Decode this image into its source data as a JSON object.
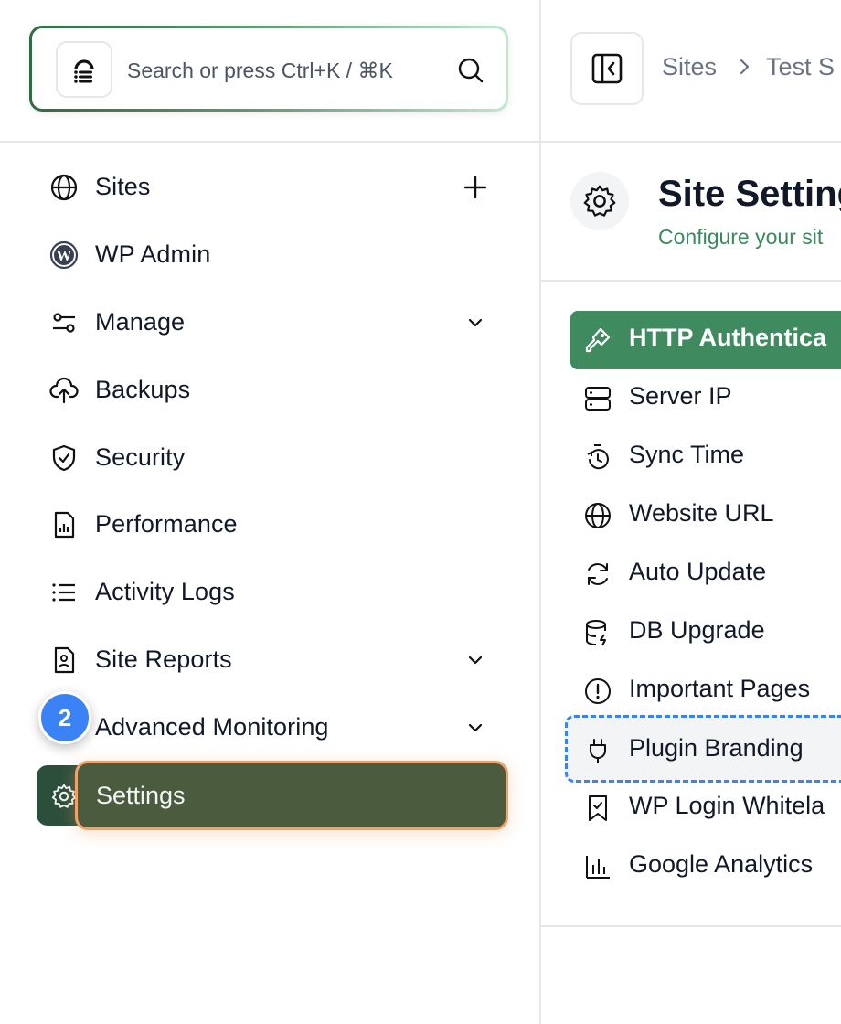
{
  "search": {
    "placeholder": "Search or press Ctrl+K / ⌘K"
  },
  "sidebar": {
    "items": [
      {
        "label": "Sites",
        "icon": "globe-icon",
        "trail": "plus-icon"
      },
      {
        "label": "WP Admin",
        "icon": "wordpress-icon"
      },
      {
        "label": "Manage",
        "icon": "sliders-icon",
        "trail": "chevron-down-icon"
      },
      {
        "label": "Backups",
        "icon": "cloud-upload-icon"
      },
      {
        "label": "Security",
        "icon": "shield-check-icon"
      },
      {
        "label": "Performance",
        "icon": "chart-file-icon"
      },
      {
        "label": "Activity Logs",
        "icon": "list-icon"
      },
      {
        "label": "Site Reports",
        "icon": "report-icon",
        "trail": "chevron-down-icon"
      },
      {
        "label": "Advanced Monitoring",
        "icon": "monitor-icon",
        "trail": "chevron-down-icon"
      },
      {
        "label": "Settings",
        "icon": "gear-icon",
        "active": true
      }
    ],
    "step_badge": "2"
  },
  "header": {
    "breadcrumb": [
      "Sites",
      "Test S"
    ]
  },
  "main": {
    "title": "Site Setting",
    "subtitle": "Configure your sit",
    "settings": [
      {
        "label": "HTTP Authentica",
        "icon": "key-icon",
        "active": true
      },
      {
        "label": "Server IP",
        "icon": "server-icon"
      },
      {
        "label": "Sync Time",
        "icon": "timer-icon"
      },
      {
        "label": "Website URL",
        "icon": "globe-icon"
      },
      {
        "label": "Auto Update",
        "icon": "refresh-icon"
      },
      {
        "label": "DB Upgrade",
        "icon": "database-icon"
      },
      {
        "label": "Important Pages",
        "icon": "alert-circle-icon"
      },
      {
        "label": "Plugin Branding",
        "icon": "plug-icon",
        "hovered": true
      },
      {
        "label": "WP Login Whitela",
        "icon": "bookmark-icon"
      },
      {
        "label": "Google Analytics",
        "icon": "bar-chart-icon"
      }
    ]
  },
  "colors": {
    "accent_green": "#3f8a5e",
    "active_nav_bg": "#2c4f3c",
    "highlight_border": "#f0a26a",
    "badge_blue": "#3b82f6",
    "subtitle_green": "#3a8a5c"
  }
}
